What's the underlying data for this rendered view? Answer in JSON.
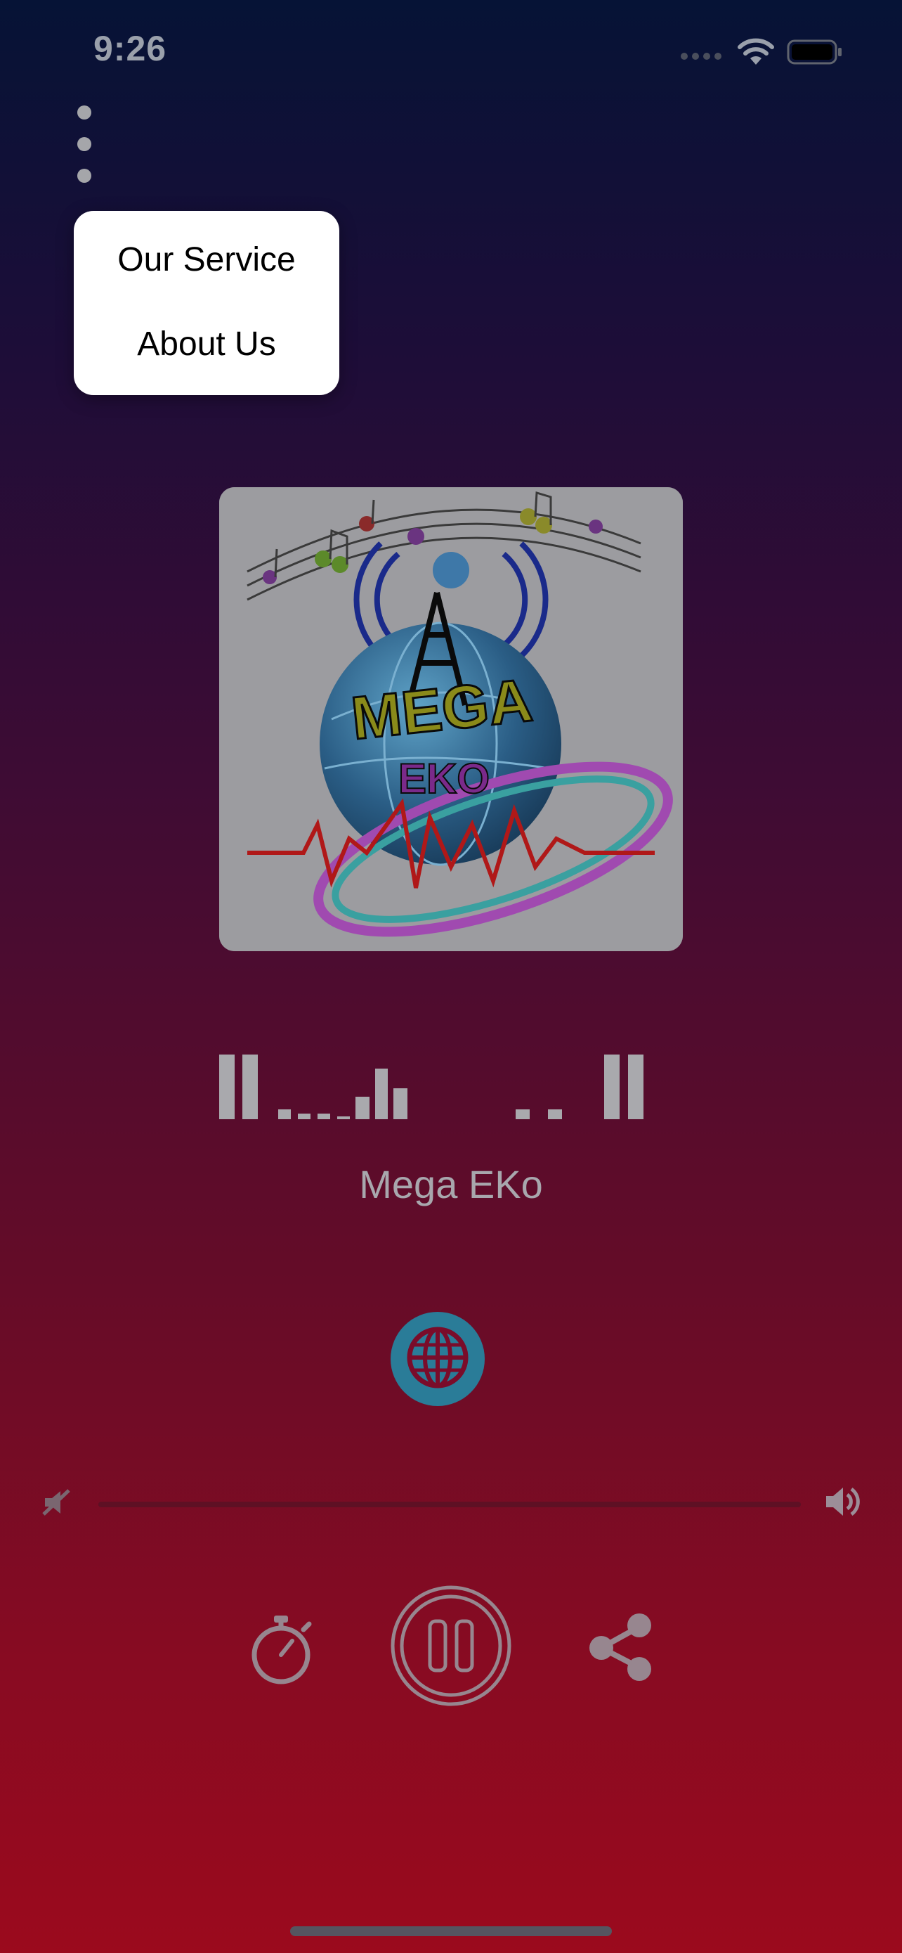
{
  "status_bar": {
    "time": "9:26"
  },
  "menu": {
    "items": [
      {
        "label": "Our Service"
      },
      {
        "label": "About Us"
      }
    ]
  },
  "player": {
    "station_name": "Mega EKo",
    "artwork_text": {
      "top": "MEGA",
      "bottom": "EKO"
    },
    "volume_level": 0.0,
    "state": "playing"
  },
  "icons": {
    "more": "more-vertical-icon",
    "website": "globe-icon",
    "volume_min": "volume-mute-icon",
    "volume_max": "volume-high-icon",
    "timer": "stopwatch-icon",
    "play_pause": "pause-icon",
    "share": "share-icon"
  },
  "colors": {
    "background_top": "#061336",
    "background_bottom": "#9b0a1d",
    "website_button": "#2a7c98",
    "control_tint": "#a9a9ad"
  }
}
